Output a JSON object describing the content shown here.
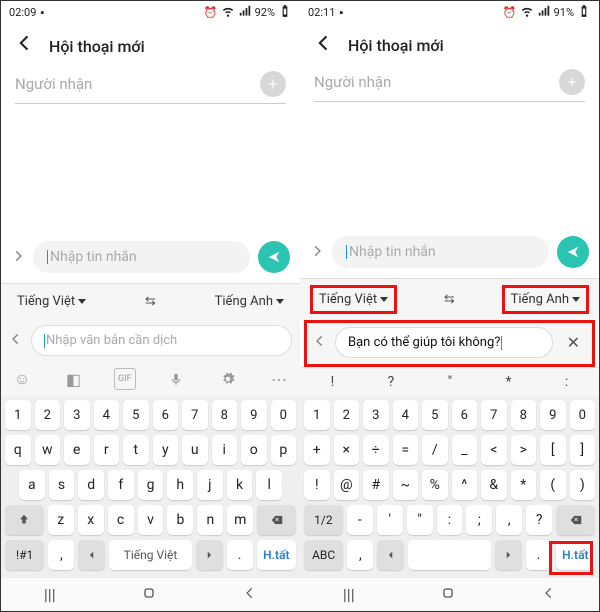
{
  "left": {
    "status": {
      "time": "02:09",
      "battery": "92%"
    },
    "header": {
      "title": "Hội thoại mới"
    },
    "recipient": {
      "placeholder": "Người nhận"
    },
    "message": {
      "placeholder": "Nhập tin nhắn"
    },
    "translate": {
      "src_lang": "Tiếng Việt",
      "dst_lang": "Tiếng Anh",
      "input_placeholder": "Nhập văn bản cần dịch"
    },
    "keyboard": {
      "row1": [
        "1",
        "2",
        "3",
        "4",
        "5",
        "6",
        "7",
        "8",
        "9",
        "0"
      ],
      "row2": [
        "q",
        "w",
        "e",
        "r",
        "t",
        "y",
        "u",
        "i",
        "o",
        "p"
      ],
      "row3": [
        "a",
        "s",
        "d",
        "f",
        "g",
        "h",
        "j",
        "k",
        "l"
      ],
      "row4": [
        "z",
        "x",
        "c",
        "v",
        "b",
        "n",
        "m"
      ],
      "sym_label": "!#1",
      "comma": ",",
      "space_label": "Tiếng Việt",
      "period": ".",
      "action_label": "H.tất"
    }
  },
  "right": {
    "status": {
      "time": "02:11",
      "battery": "91%"
    },
    "header": {
      "title": "Hội thoại mới"
    },
    "recipient": {
      "placeholder": "Người nhận"
    },
    "message": {
      "placeholder": "Nhập tin nhắn"
    },
    "translate": {
      "src_lang": "Tiếng Việt",
      "dst_lang": "Tiếng Anh",
      "input_value": "Bạn có thể giúp tôi không?"
    },
    "suggestions": [
      "!",
      "?",
      "\"",
      "*",
      ":"
    ],
    "keyboard": {
      "row1": [
        "1",
        "2",
        "3",
        "4",
        "5",
        "6",
        "7",
        "8",
        "9",
        "0"
      ],
      "row2": [
        "+",
        "×",
        "÷",
        "=",
        "/",
        "_",
        "<",
        ">",
        "[",
        "]"
      ],
      "row3": [
        "!",
        "@",
        "#",
        "~",
        "%",
        "^",
        "&",
        "*",
        "(",
        ")"
      ],
      "row4": [
        "-",
        "'",
        "\"",
        ":",
        ";",
        ",",
        "?"
      ],
      "page_label": "1/2",
      "sym_label": "ABC",
      "comma": ",",
      "space_label": "",
      "period": ".",
      "action_label": "H.tất"
    }
  },
  "icons": {
    "back": "‹",
    "plus": "+",
    "swap": "⇆",
    "close": "✕"
  }
}
